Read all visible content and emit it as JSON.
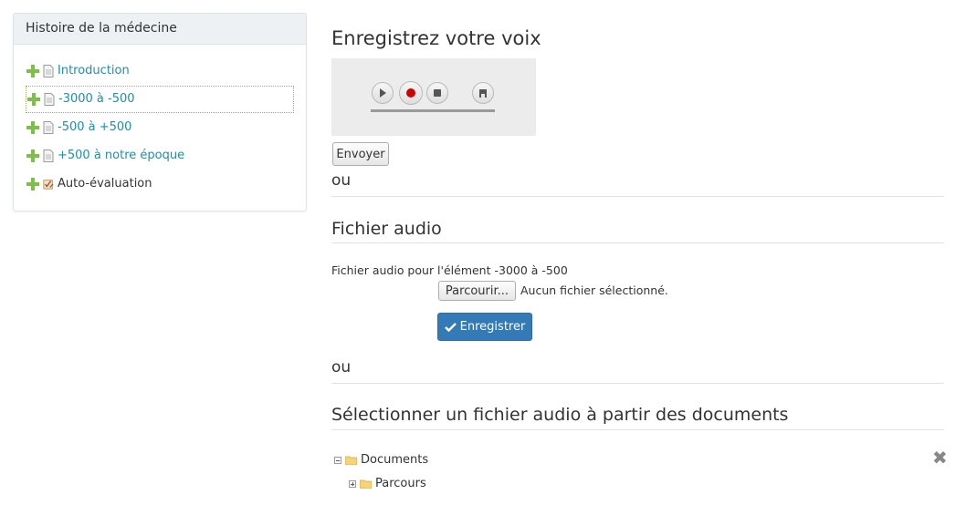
{
  "sidebar": {
    "title": "Histoire de la médecine",
    "items": [
      {
        "label": "Introduction",
        "icon": "document-icon",
        "link": true
      },
      {
        "label": "-3000 à -500",
        "icon": "document-icon",
        "link": true,
        "active": true
      },
      {
        "label": "-500 à +500",
        "icon": "document-icon",
        "link": true
      },
      {
        "label": "+500 à notre époque",
        "icon": "document-icon",
        "link": true
      },
      {
        "label": "Auto-évaluation",
        "icon": "quiz-icon",
        "link": false
      }
    ]
  },
  "record": {
    "title": "Enregistrez votre voix",
    "send_label": "Envoyer"
  },
  "or_label": "ou",
  "upload": {
    "title": "Fichier audio",
    "field_label": "Fichier audio pour l'élément -3000 à -500",
    "browse_label": "Parcourir...",
    "no_file_text": "Aucun fichier sélectionné.",
    "save_label": "Enregistrer"
  },
  "documents": {
    "title": "Sélectionner un fichier audio à partir des documents",
    "root": "Documents",
    "child": "Parcours"
  },
  "colors": {
    "link": "#1c8fa8",
    "primary": "#337ab7",
    "plus_green": "#7cc04a",
    "record_red": "#cc0000"
  }
}
